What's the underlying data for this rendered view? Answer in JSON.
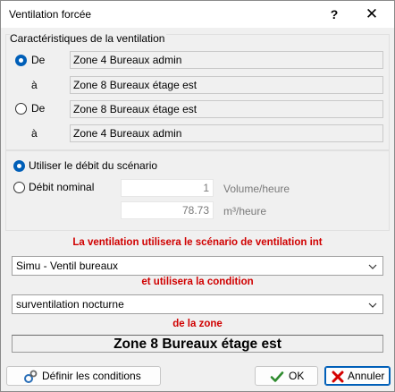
{
  "window": {
    "title": "Ventilation forcée",
    "help_label": "?",
    "close_label": "✕"
  },
  "characteristics": {
    "group_title": "Caractéristiques de la ventilation",
    "option1": {
      "radio_label": "De",
      "from_label": "à",
      "from_zone": "Zone 4 Bureaux admin",
      "to_zone": "Zone 8 Bureaux étage est",
      "selected": true
    },
    "option2": {
      "radio_label": "De",
      "from_label": "à",
      "from_zone": "Zone 8 Bureaux étage est",
      "to_zone": "Zone 4 Bureaux admin",
      "selected": false
    }
  },
  "flow": {
    "use_scenario_label": "Utiliser le débit du scénario",
    "use_scenario_selected": true,
    "nominal_label": "Débit nominal",
    "nominal_selected": false,
    "volume_value": "1",
    "volume_unit": "Volume/heure",
    "m3_value": "78.73",
    "m3_unit": "m³/heure"
  },
  "scenario": {
    "label": "La ventilation utilisera le scénario de ventilation int",
    "selected": "Simu - Ventil bureaux"
  },
  "condition": {
    "label": "et utilisera la condition",
    "selected": "surventilation nocturne"
  },
  "zone": {
    "label": "de la zone",
    "name": "Zone 8 Bureaux étage est"
  },
  "buttons": {
    "define_conditions": "Définir les conditions",
    "ok": "OK",
    "cancel": "Annuler"
  },
  "colors": {
    "accent": "#005fb8",
    "warning_red": "#d00000",
    "ok_check": "#2e8b2e",
    "cancel_x": "#d40000"
  }
}
